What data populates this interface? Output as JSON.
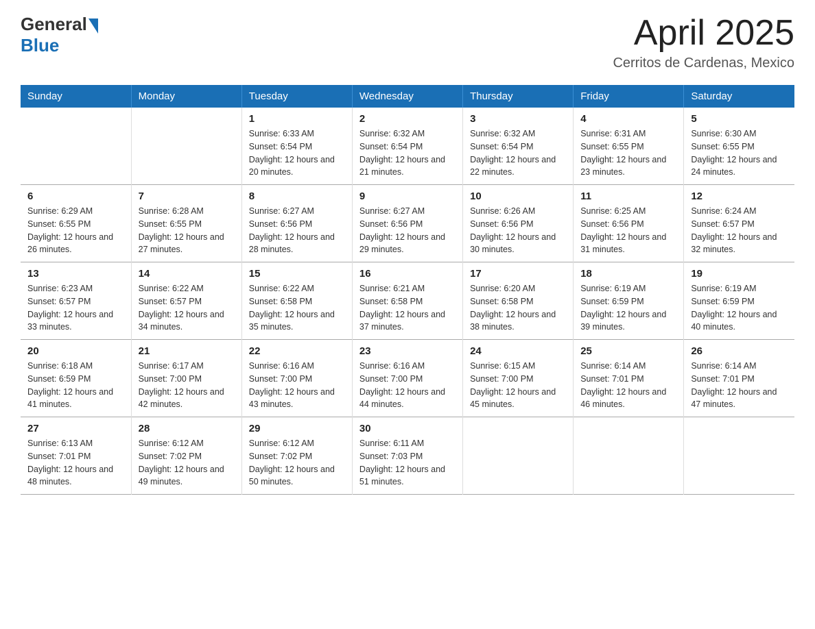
{
  "header": {
    "title": "April 2025",
    "subtitle": "Cerritos de Cardenas, Mexico"
  },
  "logo": {
    "general": "General",
    "blue": "Blue"
  },
  "days_of_week": [
    "Sunday",
    "Monday",
    "Tuesday",
    "Wednesday",
    "Thursday",
    "Friday",
    "Saturday"
  ],
  "weeks": [
    [
      {
        "day": "",
        "sunrise": "",
        "sunset": "",
        "daylight": ""
      },
      {
        "day": "",
        "sunrise": "",
        "sunset": "",
        "daylight": ""
      },
      {
        "day": "1",
        "sunrise": "Sunrise: 6:33 AM",
        "sunset": "Sunset: 6:54 PM",
        "daylight": "Daylight: 12 hours and 20 minutes."
      },
      {
        "day": "2",
        "sunrise": "Sunrise: 6:32 AM",
        "sunset": "Sunset: 6:54 PM",
        "daylight": "Daylight: 12 hours and 21 minutes."
      },
      {
        "day": "3",
        "sunrise": "Sunrise: 6:32 AM",
        "sunset": "Sunset: 6:54 PM",
        "daylight": "Daylight: 12 hours and 22 minutes."
      },
      {
        "day": "4",
        "sunrise": "Sunrise: 6:31 AM",
        "sunset": "Sunset: 6:55 PM",
        "daylight": "Daylight: 12 hours and 23 minutes."
      },
      {
        "day": "5",
        "sunrise": "Sunrise: 6:30 AM",
        "sunset": "Sunset: 6:55 PM",
        "daylight": "Daylight: 12 hours and 24 minutes."
      }
    ],
    [
      {
        "day": "6",
        "sunrise": "Sunrise: 6:29 AM",
        "sunset": "Sunset: 6:55 PM",
        "daylight": "Daylight: 12 hours and 26 minutes."
      },
      {
        "day": "7",
        "sunrise": "Sunrise: 6:28 AM",
        "sunset": "Sunset: 6:55 PM",
        "daylight": "Daylight: 12 hours and 27 minutes."
      },
      {
        "day": "8",
        "sunrise": "Sunrise: 6:27 AM",
        "sunset": "Sunset: 6:56 PM",
        "daylight": "Daylight: 12 hours and 28 minutes."
      },
      {
        "day": "9",
        "sunrise": "Sunrise: 6:27 AM",
        "sunset": "Sunset: 6:56 PM",
        "daylight": "Daylight: 12 hours and 29 minutes."
      },
      {
        "day": "10",
        "sunrise": "Sunrise: 6:26 AM",
        "sunset": "Sunset: 6:56 PM",
        "daylight": "Daylight: 12 hours and 30 minutes."
      },
      {
        "day": "11",
        "sunrise": "Sunrise: 6:25 AM",
        "sunset": "Sunset: 6:56 PM",
        "daylight": "Daylight: 12 hours and 31 minutes."
      },
      {
        "day": "12",
        "sunrise": "Sunrise: 6:24 AM",
        "sunset": "Sunset: 6:57 PM",
        "daylight": "Daylight: 12 hours and 32 minutes."
      }
    ],
    [
      {
        "day": "13",
        "sunrise": "Sunrise: 6:23 AM",
        "sunset": "Sunset: 6:57 PM",
        "daylight": "Daylight: 12 hours and 33 minutes."
      },
      {
        "day": "14",
        "sunrise": "Sunrise: 6:22 AM",
        "sunset": "Sunset: 6:57 PM",
        "daylight": "Daylight: 12 hours and 34 minutes."
      },
      {
        "day": "15",
        "sunrise": "Sunrise: 6:22 AM",
        "sunset": "Sunset: 6:58 PM",
        "daylight": "Daylight: 12 hours and 35 minutes."
      },
      {
        "day": "16",
        "sunrise": "Sunrise: 6:21 AM",
        "sunset": "Sunset: 6:58 PM",
        "daylight": "Daylight: 12 hours and 37 minutes."
      },
      {
        "day": "17",
        "sunrise": "Sunrise: 6:20 AM",
        "sunset": "Sunset: 6:58 PM",
        "daylight": "Daylight: 12 hours and 38 minutes."
      },
      {
        "day": "18",
        "sunrise": "Sunrise: 6:19 AM",
        "sunset": "Sunset: 6:59 PM",
        "daylight": "Daylight: 12 hours and 39 minutes."
      },
      {
        "day": "19",
        "sunrise": "Sunrise: 6:19 AM",
        "sunset": "Sunset: 6:59 PM",
        "daylight": "Daylight: 12 hours and 40 minutes."
      }
    ],
    [
      {
        "day": "20",
        "sunrise": "Sunrise: 6:18 AM",
        "sunset": "Sunset: 6:59 PM",
        "daylight": "Daylight: 12 hours and 41 minutes."
      },
      {
        "day": "21",
        "sunrise": "Sunrise: 6:17 AM",
        "sunset": "Sunset: 7:00 PM",
        "daylight": "Daylight: 12 hours and 42 minutes."
      },
      {
        "day": "22",
        "sunrise": "Sunrise: 6:16 AM",
        "sunset": "Sunset: 7:00 PM",
        "daylight": "Daylight: 12 hours and 43 minutes."
      },
      {
        "day": "23",
        "sunrise": "Sunrise: 6:16 AM",
        "sunset": "Sunset: 7:00 PM",
        "daylight": "Daylight: 12 hours and 44 minutes."
      },
      {
        "day": "24",
        "sunrise": "Sunrise: 6:15 AM",
        "sunset": "Sunset: 7:00 PM",
        "daylight": "Daylight: 12 hours and 45 minutes."
      },
      {
        "day": "25",
        "sunrise": "Sunrise: 6:14 AM",
        "sunset": "Sunset: 7:01 PM",
        "daylight": "Daylight: 12 hours and 46 minutes."
      },
      {
        "day": "26",
        "sunrise": "Sunrise: 6:14 AM",
        "sunset": "Sunset: 7:01 PM",
        "daylight": "Daylight: 12 hours and 47 minutes."
      }
    ],
    [
      {
        "day": "27",
        "sunrise": "Sunrise: 6:13 AM",
        "sunset": "Sunset: 7:01 PM",
        "daylight": "Daylight: 12 hours and 48 minutes."
      },
      {
        "day": "28",
        "sunrise": "Sunrise: 6:12 AM",
        "sunset": "Sunset: 7:02 PM",
        "daylight": "Daylight: 12 hours and 49 minutes."
      },
      {
        "day": "29",
        "sunrise": "Sunrise: 6:12 AM",
        "sunset": "Sunset: 7:02 PM",
        "daylight": "Daylight: 12 hours and 50 minutes."
      },
      {
        "day": "30",
        "sunrise": "Sunrise: 6:11 AM",
        "sunset": "Sunset: 7:03 PM",
        "daylight": "Daylight: 12 hours and 51 minutes."
      },
      {
        "day": "",
        "sunrise": "",
        "sunset": "",
        "daylight": ""
      },
      {
        "day": "",
        "sunrise": "",
        "sunset": "",
        "daylight": ""
      },
      {
        "day": "",
        "sunrise": "",
        "sunset": "",
        "daylight": ""
      }
    ]
  ]
}
